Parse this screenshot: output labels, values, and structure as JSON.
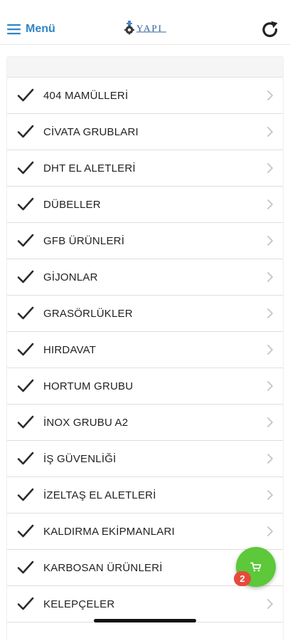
{
  "header": {
    "menu_label": "Menü",
    "logo_text": "YAPI",
    "refresh_icon": "refresh-icon"
  },
  "categories": [
    {
      "label": "404 MAMÜLLERİ"
    },
    {
      "label": "CİVATA GRUBLARI"
    },
    {
      "label": "DHT EL ALETLERİ"
    },
    {
      "label": "DÜBELLER"
    },
    {
      "label": "GFB ÜRÜNLERİ"
    },
    {
      "label": "GİJONLAR"
    },
    {
      "label": "GRASÖRLÜKLER"
    },
    {
      "label": "HIRDAVAT"
    },
    {
      "label": "HORTUM GRUBU"
    },
    {
      "label": "İNOX GRUBU A2"
    },
    {
      "label": "İŞ GÜVENLİĞİ"
    },
    {
      "label": "İZELTAŞ EL ALETLERİ"
    },
    {
      "label": "KALDIRMA EKİPMANLARI"
    },
    {
      "label": "KARBOSAN ÜRÜNLERİ"
    },
    {
      "label": "KELEPÇELER"
    }
  ],
  "cart": {
    "count": "2"
  },
  "colors": {
    "accent": "#2f86c6",
    "fab": "#5cc83a",
    "badge": "#e54b3c"
  }
}
